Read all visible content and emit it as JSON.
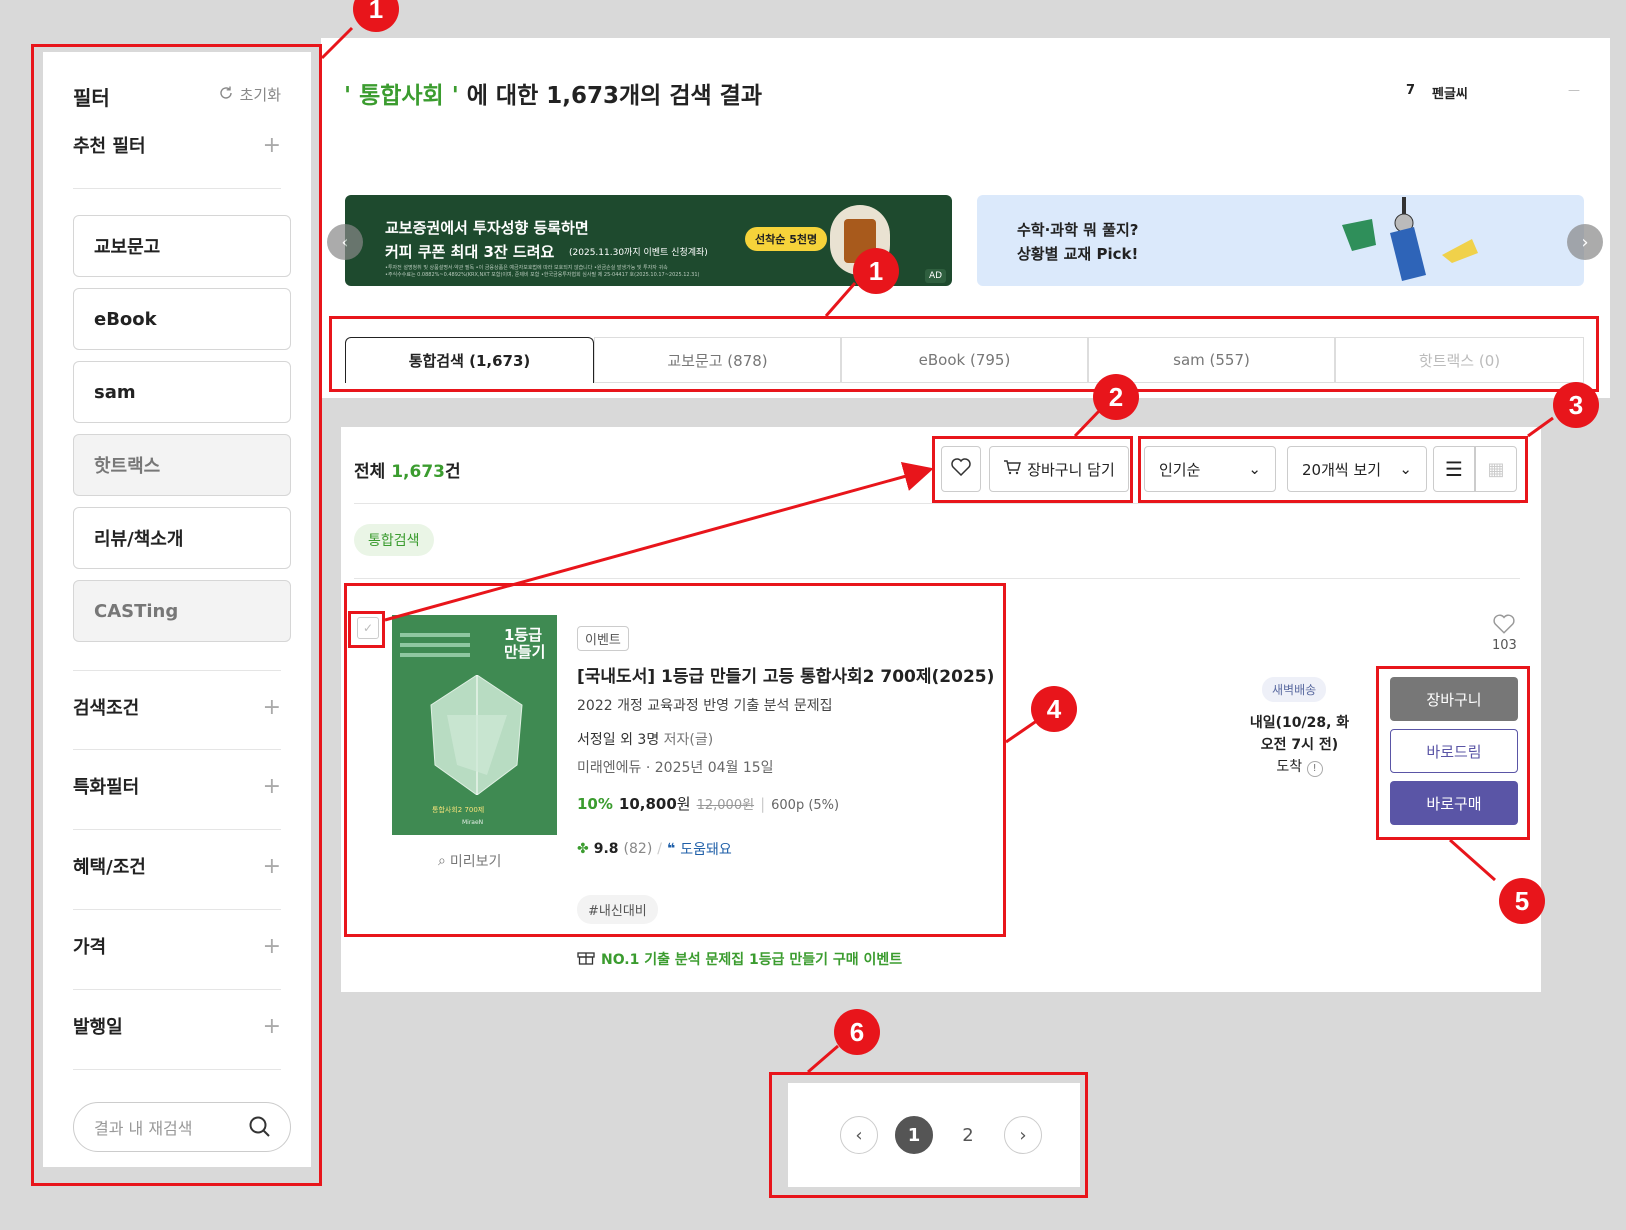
{
  "sidebar": {
    "title": "필터",
    "reset_label": "초기화",
    "recommended_filter": "추천 필터",
    "categories": [
      "교보문고",
      "eBook",
      "sam",
      "핫트랙스",
      "리뷰/책소개",
      "CASTing"
    ],
    "sections": [
      "검색조건",
      "특화필터",
      "혜택/조건",
      "가격",
      "발행일"
    ],
    "search_placeholder": "결과 내 재검색"
  },
  "header": {
    "keyword": "통합사회",
    "title_rest": "에 대한 1,673개의 검색 결과",
    "pen_count": "7",
    "pen_label": "펜글씨",
    "dash": "—"
  },
  "banner1": {
    "line1": "교보증권에서 투자성향 등록하면",
    "line2": "커피 쿠폰 최대 3잔 드려요",
    "note": "(2025.11.30까지 이벤트 신청계좌)",
    "badge": "선착순 5천명",
    "ad": "AD",
    "fine": "•투자전 설명청취 및 상품설명서·약관 필독 •이 금융상품은 예금자보호법에 따라 보호되지 않습니다 •원금손실 발생가능 및 투자자 귀속",
    "fine2": "•주식수수료는 0.0882%~0.4892%(KRX,NXT 포함)이며, 준제비 포함 •한국금융투자협회 심사필 제 25-04417 호(2025.10.17~2025.12.31)"
  },
  "banner2": {
    "line1": "수학·과학 뭐 풀지?",
    "line2": "상황별 교재 Pick!"
  },
  "tabs": [
    "통합검색 (1,673)",
    "교보문고 (878)",
    "eBook (795)",
    "sam (557)",
    "핫트랙스 (0)"
  ],
  "toolbar": {
    "total_prefix": "전체",
    "total_count": "1,673",
    "total_suffix": "건",
    "cart_button": "장바구니 담기",
    "sort": "인기순",
    "per_page": "20개씩 보기",
    "chip": "통합검색"
  },
  "product": {
    "badge": "이벤트",
    "title": "[국내도서] 1등급 만들기 고등 통합사회2 700제(2025)",
    "subtitle": "2022 개정 교육과정 반영 기출 분석 문제집",
    "author": "서정일 외 3명",
    "author_role": "저자(글)",
    "publisher": "미래엔에듀 · 2025년 04월 15일",
    "discount": "10%",
    "price": "10,800",
    "price_unit": "원",
    "orig_price": "12,000원",
    "points": "600p (5%)",
    "rating": "9.8",
    "rating_count": "(82)",
    "helpful": "도움돼요",
    "tag": "#내신대비",
    "preview": "미리보기",
    "cover_title1": "1등급",
    "cover_title2": "만들기",
    "cover_sub": "통합사회2 700제",
    "cover_pub": "MiraeN",
    "like_count": "103",
    "delivery_badge": "새벽배송",
    "delivery_line1": "내일(10/28, 화",
    "delivery_line2": "오전 7시 전)",
    "delivery_line3": "도착",
    "btn_cart": "장바구니",
    "btn_gift": "바로드림",
    "btn_buy": "바로구매",
    "event_text": "NO.1 기출 분석 문제집 1등급 만들기 구매 이벤트"
  },
  "pagination": {
    "pages": [
      "1",
      "2"
    ],
    "current": "1"
  },
  "markers": [
    "1",
    "1",
    "2",
    "3",
    "4",
    "5",
    "6"
  ],
  "colors": {
    "accent_green": "#3b9c2f",
    "highlight_red": "#e8151b",
    "buy_purple": "#5a55a6",
    "cart_gray": "#777777",
    "banner_green": "#1e4a2e",
    "banner_blue": "#dbe9fb"
  }
}
